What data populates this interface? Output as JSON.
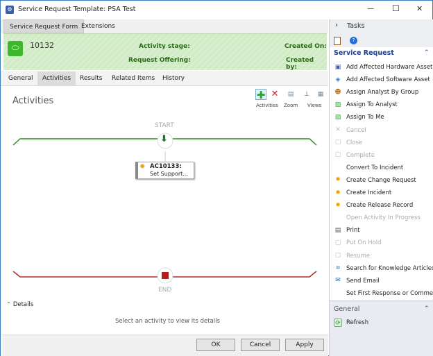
{
  "window": {
    "title": "Service Request Template: PSA Test",
    "min": "—",
    "max": "☐",
    "close": "✕"
  },
  "top_tabs": [
    "Service Request Form",
    "Extensions"
  ],
  "header": {
    "id": "10132",
    "activity_stage_label": "Activity stage:",
    "request_offering_label": "Request Offering:",
    "created_on_label": "Created On:",
    "created_by_label": "Created by:"
  },
  "tabs": [
    "General",
    "Activities",
    "Results",
    "Related Items",
    "History"
  ],
  "activities": {
    "title": "Activities",
    "toolbar_groups": [
      "Activities",
      "Zoom",
      "Views"
    ],
    "start": "START",
    "end": "END",
    "activity_id": "AC10133:",
    "activity_title": "Set Support...",
    "details_label": "Details",
    "details_hint": "Select an activity to view its details"
  },
  "buttons": {
    "ok": "OK",
    "cancel": "Cancel",
    "apply": "Apply"
  },
  "tasks": {
    "header": "Tasks",
    "section": "Service Request",
    "items": [
      {
        "label": "Add Affected Hardware Asset",
        "icon": "hardware-icon",
        "disabled": false
      },
      {
        "label": "Add Affected Software Asset",
        "icon": "software-icon",
        "disabled": false
      },
      {
        "label": "Assign Analyst By Group",
        "icon": "group-icon",
        "disabled": false
      },
      {
        "label": "Assign To Analyst",
        "icon": "assign-icon",
        "disabled": false
      },
      {
        "label": "Assign To Me",
        "icon": "assign-icon",
        "disabled": false
      },
      {
        "label": "Cancel",
        "icon": "cancel-icon",
        "disabled": true
      },
      {
        "label": "Close",
        "icon": "close-icon",
        "disabled": true
      },
      {
        "label": "Complete",
        "icon": "complete-icon",
        "disabled": true
      },
      {
        "label": "Convert To Incident",
        "icon": "",
        "disabled": false
      },
      {
        "label": "Create Change Request",
        "icon": "sun-icon",
        "disabled": false
      },
      {
        "label": "Create Incident",
        "icon": "sun-icon",
        "disabled": false
      },
      {
        "label": "Create Release Record",
        "icon": "sun-icon",
        "disabled": false
      },
      {
        "label": "Open Activity In Progress",
        "icon": "",
        "disabled": true
      },
      {
        "label": "Print",
        "icon": "printer-icon",
        "disabled": false
      },
      {
        "label": "Put On Hold",
        "icon": "hold-icon",
        "disabled": true
      },
      {
        "label": "Resume",
        "icon": "resume-icon",
        "disabled": true
      },
      {
        "label": "Search for Knowledge Articles",
        "icon": "binoculars-icon",
        "disabled": false
      },
      {
        "label": "Send Email",
        "icon": "email-icon",
        "disabled": false
      },
      {
        "label": "Set First Response or Comment",
        "icon": "",
        "disabled": false
      }
    ],
    "general_section": "General",
    "refresh": "Refresh"
  }
}
